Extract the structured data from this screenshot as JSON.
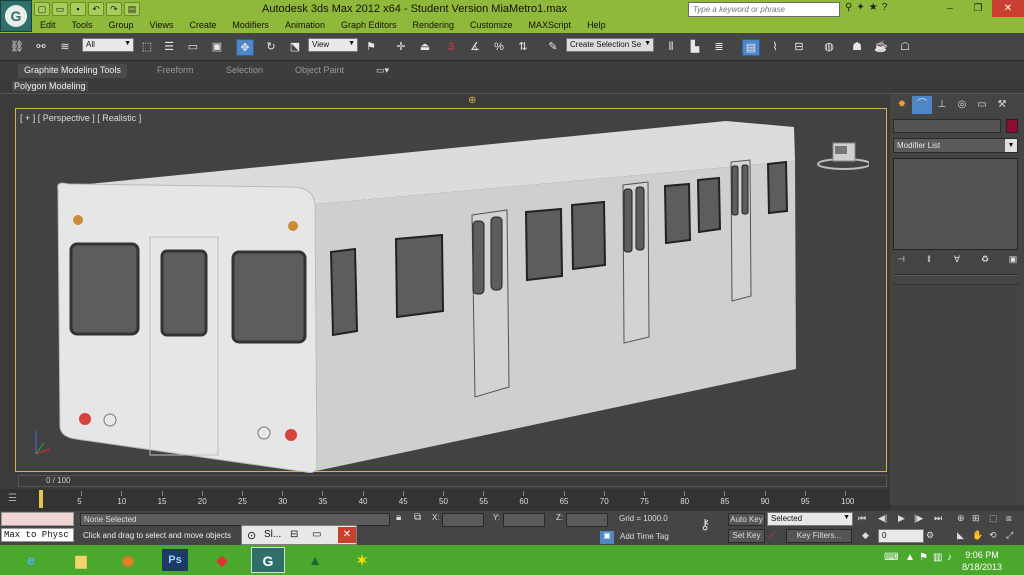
{
  "app": {
    "title": "Autodesk 3ds Max  2012 x64   - Student Version     MiaMetro1.max",
    "logo": "3ds-max-logo",
    "search_placeholder": "Type a keyword or phrase"
  },
  "quick_access": [
    "new-icon",
    "open-icon",
    "save-icon",
    "undo-icon",
    "redo-icon",
    "project-icon"
  ],
  "menu": [
    "Edit",
    "Tools",
    "Group",
    "Views",
    "Create",
    "Modifiers",
    "Animation",
    "Graph Editors",
    "Rendering",
    "Customize",
    "MAXScript",
    "Help"
  ],
  "toolbar": {
    "filter_value": "All",
    "refcoord_value": "View",
    "selection_set_placeholder": "Create Selection Se",
    "angle_snap": "3",
    "percent_snap": "%"
  },
  "ribbon": {
    "tabs": [
      "Graphite Modeling Tools",
      "Freeform",
      "Selection",
      "Object Paint"
    ],
    "sub_label": "Polygon Modeling"
  },
  "viewport": {
    "label": "[ + ] [ Perspective ] [ Realistic ]"
  },
  "command_panel": {
    "modifier_list": "Modifier List"
  },
  "timeline": {
    "frame_slider": "0 / 100",
    "ticks": [
      "5",
      "10",
      "15",
      "20",
      "25",
      "30",
      "35",
      "40",
      "45",
      "50",
      "55",
      "60",
      "65",
      "70",
      "75",
      "80",
      "85",
      "90",
      "95",
      "100"
    ]
  },
  "status": {
    "maxscript_prompt": "Max to Physc",
    "selection": "None Selected",
    "prompt": "Click and drag to select and move objects",
    "x_label": "X:",
    "y_label": "Y:",
    "z_label": "Z:",
    "grid": "Grid = 1000.0",
    "add_time_tag": "Add Time Tag",
    "auto_key": "Auto Key",
    "set_key": "Set Key",
    "key_mode": "Selected",
    "key_filters": "Key Filters...",
    "current_frame": "0"
  },
  "popup": {
    "label": "Sl..."
  },
  "taskbar": {
    "apps": [
      "ie-icon",
      "explorer-icon",
      "chrome-icon",
      "photoshop-icon",
      "sketchup-icon",
      "3dsmax-icon",
      "app-icon",
      "game-icon"
    ],
    "ps_label": "Ps",
    "time": "9:06 PM",
    "date": "8/18/2013"
  },
  "colors": {
    "title_green": "#8fb93a",
    "taskbar_green": "#4aa82c",
    "viewport_border": "#d4b44a",
    "object_color": "#8c0c32",
    "highlight_blue": "#4f86c6"
  }
}
